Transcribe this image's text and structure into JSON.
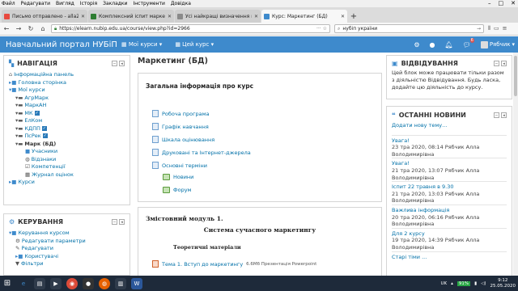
{
  "menubar": [
    "Файл",
    "Редагувати",
    "Вигляд",
    "Історія",
    "Закладки",
    "Інструменти",
    "Довідка"
  ],
  "tabs": [
    {
      "title": "Письмо отправлено - alla21",
      "color": "#e8493e",
      "active": false
    },
    {
      "title": "Комплексний іспит маркетин",
      "color": "#2e7d32",
      "active": false
    },
    {
      "title": "Усі найкращі визначення маркет",
      "color": "#8a8a8a",
      "active": false
    },
    {
      "title": "Курс: Маркетинг (БД)",
      "color": "#3e8acc",
      "active": true
    }
  ],
  "url": "https://elearn.nubip.edu.ua/course/view.php?id=2966",
  "search_value": "нубіп україни",
  "site": {
    "brand": "Навчальний портал НУБіП",
    "my_courses": "Мої курси",
    "this_course": "Цей курс",
    "user": "Рябчик",
    "msg_count": "6"
  },
  "nav_block": {
    "title": "НАВІГАЦІЯ",
    "items": [
      {
        "label": "Інформаційна панель",
        "icon": "home-icon",
        "checked": false
      },
      {
        "label": "Головна сторінка",
        "icon": "folder-icon",
        "checked": false
      },
      {
        "label": "Мої курси",
        "icon": "folder-icon",
        "checked": false
      },
      {
        "label": "АгрМарк",
        "icon": "course-icon",
        "checked": false
      },
      {
        "label": "МаркАН",
        "icon": "course-icon",
        "checked": false
      },
      {
        "label": "МК",
        "icon": "course-icon",
        "checked": true
      },
      {
        "label": "ЕлКом",
        "icon": "course-icon",
        "checked": false
      },
      {
        "label": "КДПП",
        "icon": "course-icon",
        "checked": true
      },
      {
        "label": "ПсРек",
        "icon": "course-icon",
        "checked": true
      },
      {
        "label": "Марк (БД)",
        "icon": "course-icon",
        "checked": false
      },
      {
        "label": "Учасники",
        "icon": "folder-icon",
        "checked": false
      },
      {
        "label": "Відзнаки",
        "icon": "shield-icon",
        "checked": false
      },
      {
        "label": "Компетенції",
        "icon": "check-icon",
        "checked": false
      },
      {
        "label": "Журнал оцінок",
        "icon": "grid-icon",
        "checked": false
      },
      {
        "label": "Курси",
        "icon": "folder-icon",
        "checked": false
      }
    ]
  },
  "admin_block": {
    "title": "КЕРУВАННЯ",
    "items": [
      {
        "label": "Керування курсом",
        "icon": "folder-icon"
      },
      {
        "label": "Редагувати параметри",
        "icon": "gear-icon"
      },
      {
        "label": "Редагувати",
        "icon": "pencil-icon"
      },
      {
        "label": "Користувачі",
        "icon": "folder-icon"
      },
      {
        "label": "Фільтри",
        "icon": "filter-icon"
      }
    ]
  },
  "main": {
    "page_title": "Маркетинг (БД)",
    "general_title": "Загальна інформація про курс",
    "activities": [
      {
        "label": "Робоча програма",
        "type": "doc"
      },
      {
        "label": "Графік навчання",
        "type": "doc"
      },
      {
        "label": "Шкала оцінювання",
        "type": "doc"
      },
      {
        "label": "Друковані та Інтернет-джерела",
        "type": "doc"
      },
      {
        "label": "Основні терміни",
        "type": "doc"
      },
      {
        "label": "Новини",
        "type": "forum"
      },
      {
        "label": "Форум",
        "type": "forum"
      }
    ],
    "module_title": "Змістовний модуль 1.",
    "module_subtitle": "Система сучасного маркетингу",
    "theory_label": "Теоретичні матеріали",
    "topic1": {
      "label": "Тема 1. Вступ до маркетингу",
      "meta": "6.6Мб Презентація Powerpoint"
    }
  },
  "attendance_block": {
    "title": "ВІДВІДУВАННЯ",
    "text": "Цей блок може працювати тільки разом з діяльністю Відвідування. Будь ласка, додайте цю діяльність до курсу."
  },
  "news_block": {
    "title": "ОСТАННІ НОВИНИ",
    "add_link": "Додати нову тему...",
    "items": [
      {
        "title": "Увага!",
        "date": "23 тра 2020, 08:14 Рябчик Алла",
        "author": "Володимирівна"
      },
      {
        "title": "Увага!",
        "date": "21 тра 2020, 13:07 Рябчик Алла",
        "author": "Володимирівна"
      },
      {
        "title": "Іспит 22 травня в 9.30",
        "date": "21 тра 2020, 13:03 Рябчик Алла",
        "author": "Володимирівна"
      },
      {
        "title": "Важлива інформація",
        "date": "20 тра 2020, 06:16 Рябчик Алла",
        "author": "Володимирівна"
      },
      {
        "title": "Для 2 курсу",
        "date": "19 тра 2020, 14:39 Рябчик Алла",
        "author": "Володимирівна"
      }
    ],
    "older": "Старі тіми ..."
  },
  "tray": {
    "lang": "UK",
    "battery": "91%",
    "time": "9:12",
    "date": "25.05.2020"
  }
}
